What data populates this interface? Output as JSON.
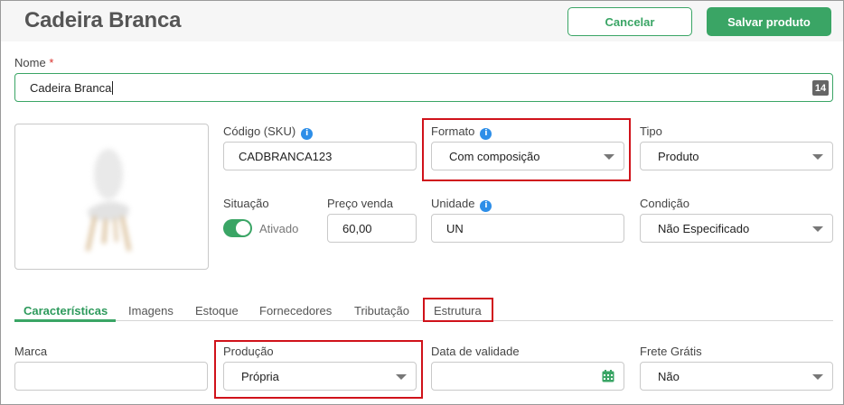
{
  "header": {
    "title": "Cadeira Branca",
    "cancel_label": "Cancelar",
    "save_label": "Salvar produto"
  },
  "name_field": {
    "label": "Nome",
    "required_mark": "*",
    "value": "Cadeira Branca",
    "counter": "14"
  },
  "sku": {
    "label": "Código (SKU)",
    "info": "i",
    "value": "CADBRANCA123"
  },
  "formato": {
    "label": "Formato",
    "info": "i",
    "value": "Com composição"
  },
  "tipo": {
    "label": "Tipo",
    "value": "Produto"
  },
  "situacao": {
    "label": "Situação",
    "toggle_label": "Ativado",
    "on": true
  },
  "preco": {
    "label": "Preço venda",
    "value": "60,00"
  },
  "unidade": {
    "label": "Unidade",
    "info": "i",
    "value": "UN"
  },
  "condicao": {
    "label": "Condição",
    "value": "Não Especificado"
  },
  "tabs": [
    {
      "label": "Características",
      "active": true
    },
    {
      "label": "Imagens"
    },
    {
      "label": "Estoque"
    },
    {
      "label": "Fornecedores"
    },
    {
      "label": "Tributação"
    },
    {
      "label": "Estrutura"
    }
  ],
  "marca": {
    "label": "Marca",
    "value": ""
  },
  "producao": {
    "label": "Produção",
    "value": "Própria"
  },
  "validade": {
    "label": "Data de validade",
    "value": ""
  },
  "frete": {
    "label": "Frete Grátis",
    "value": "Não"
  },
  "colors": {
    "accent": "#3aa565",
    "highlight": "#d0121a",
    "info": "#2d8ee8"
  },
  "icons": {
    "info": "info-circle-icon",
    "dropdown": "caret-down-icon",
    "calendar": "calendar-icon"
  }
}
